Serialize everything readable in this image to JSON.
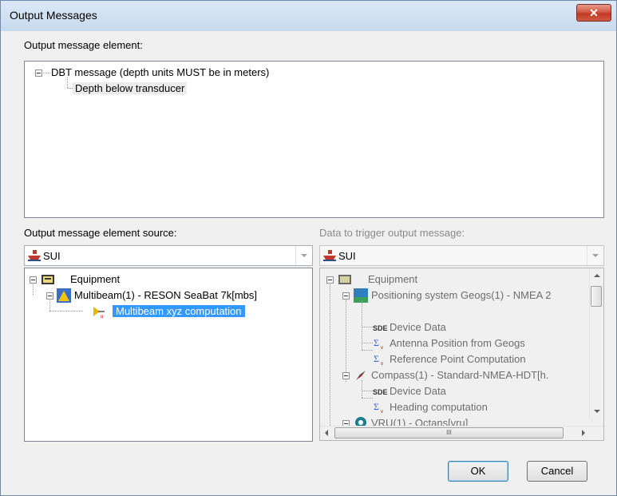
{
  "window": {
    "title": "Output Messages",
    "close_label": "✕"
  },
  "message_element": {
    "label": "Output message element:",
    "items": [
      "DBT message (depth units MUST be in meters)",
      "Depth below transducer"
    ]
  },
  "source": {
    "label": "Output message element source:",
    "combo_value": "SUI",
    "tree": {
      "equipment": "Equipment",
      "multibeam": "Multibeam(1) - RESON SeaBat 7k[mbs]",
      "computation": "Multibeam xyz computation"
    }
  },
  "trigger": {
    "label": "Data to trigger output message:",
    "combo_value": "SUI",
    "tree": {
      "equipment": "Equipment",
      "positioning": "Positioning system Geogs(1) - NMEA 2",
      "pos_device_data": "Device Data",
      "antenna_position": "Antenna Position from Geogs",
      "reference_point": "Reference Point Computation",
      "compass": "Compass(1) - Standard-NMEA-HDT[h.",
      "compass_device_data": "Device Data",
      "heading_computation": "Heading computation",
      "vru": "VRU(1) - Octans[vru]"
    },
    "scroll_h_grip": "III"
  },
  "buttons": {
    "ok": "OK",
    "cancel": "Cancel"
  }
}
